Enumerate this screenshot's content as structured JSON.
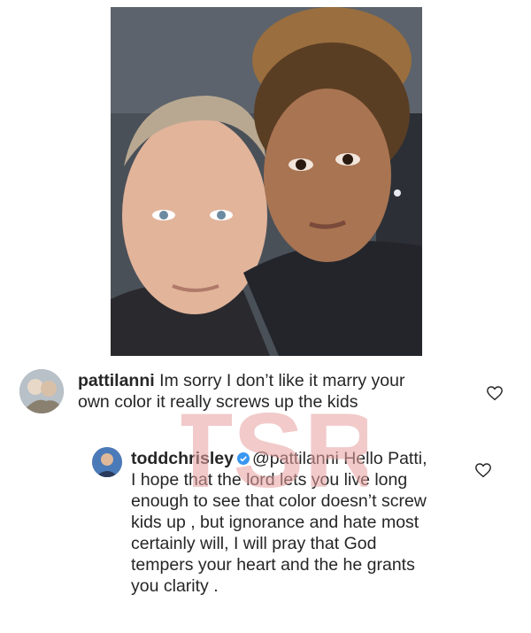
{
  "post": {
    "photo_icon": "selfie-photo"
  },
  "comments": [
    {
      "username": "pattilanni",
      "text": "Im sorry I don’t like it marry your own color it really screws up the kids",
      "verified": false,
      "like_icon": "heart-outline-icon"
    },
    {
      "username": "toddchrisley",
      "text": "@pattilanni Hello Patti, I hope that the lord lets you live long enough to see that color doesn’t screw kids up , but ignorance and hate most certainly will, I will pray that God tempers your heart and the he grants you clarity .",
      "verified": true,
      "like_icon": "heart-outline-icon"
    }
  ],
  "watermark": {
    "letters": "TSR",
    "color": "#e8a0a0"
  },
  "colors": {
    "text": "#262626",
    "verified_badge": "#3897f0",
    "heart_stroke": "#262626"
  }
}
